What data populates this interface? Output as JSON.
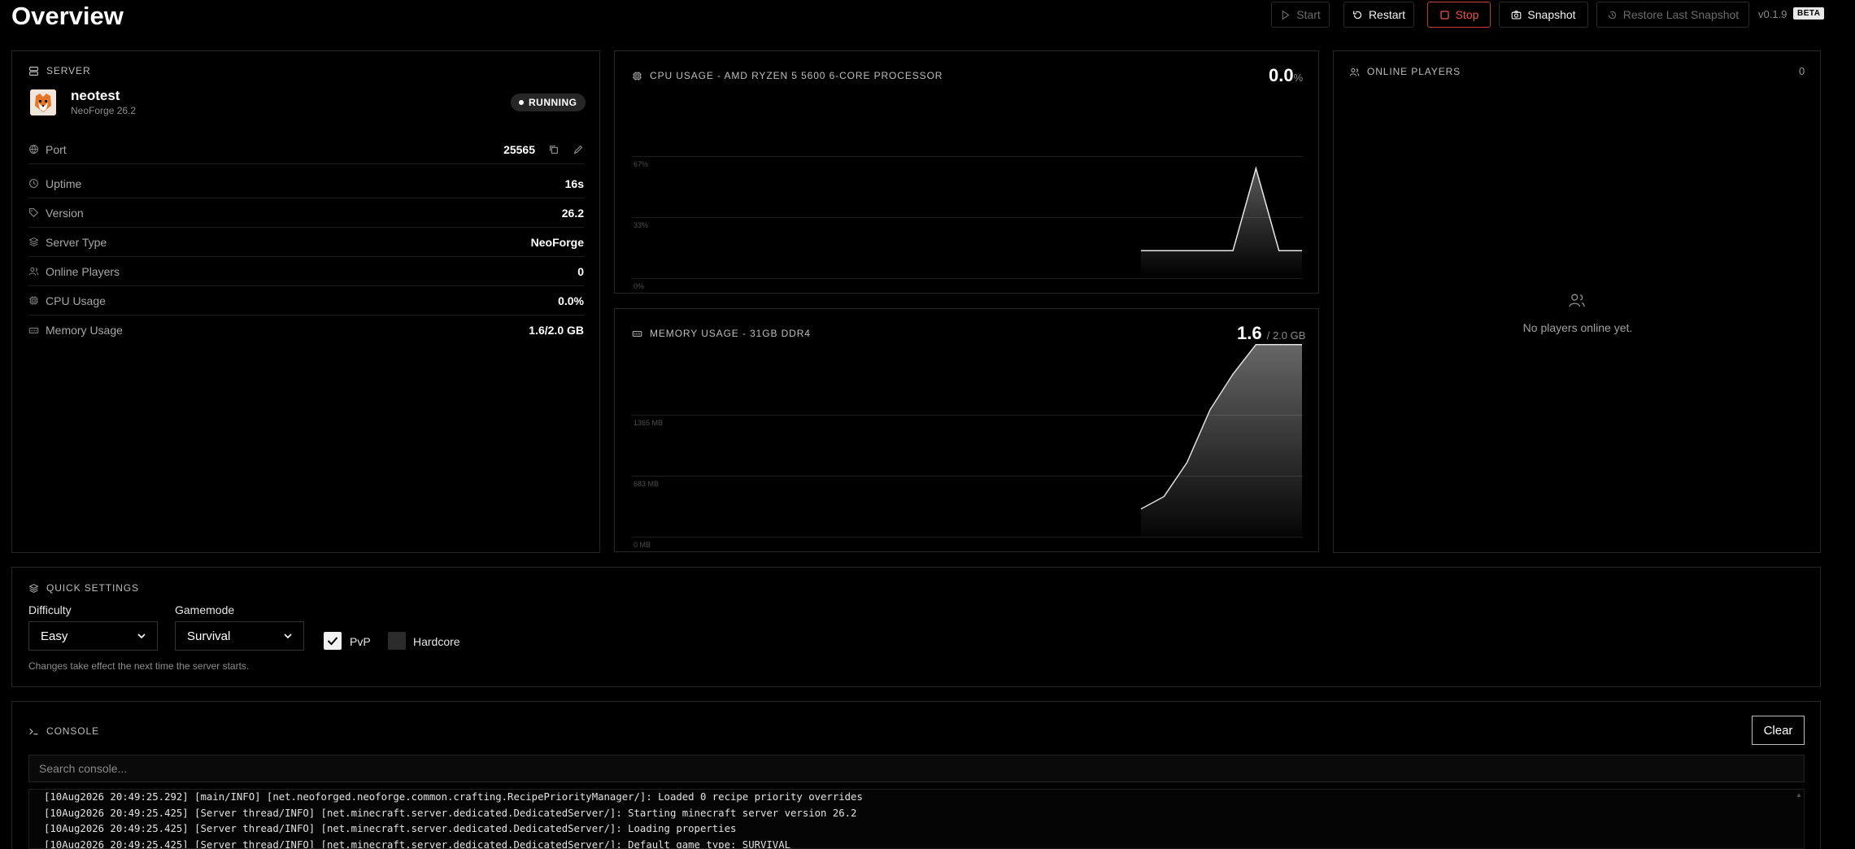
{
  "header": {
    "title": "Overview",
    "buttons": {
      "start": "Start",
      "restart": "Restart",
      "stop": "Stop",
      "snapshot": "Snapshot",
      "restore": "Restore Last Snapshot"
    },
    "version": "v0.1.9",
    "beta": "BETA"
  },
  "server": {
    "section_title": "SERVER",
    "name": "neotest",
    "subtitle": "NeoForge 26.2",
    "status": "RUNNING",
    "rows": [
      {
        "label": "Port",
        "value": "25565",
        "icon": "globe-icon"
      },
      {
        "label": "Uptime",
        "value": "16s",
        "icon": "clock-icon"
      },
      {
        "label": "Version",
        "value": "26.2",
        "icon": "tag-icon"
      },
      {
        "label": "Server Type",
        "value": "NeoForge",
        "icon": "layers-icon"
      },
      {
        "label": "Online Players",
        "value": "0",
        "icon": "users-icon"
      },
      {
        "label": "CPU Usage",
        "value": "0.0%",
        "icon": "cpu-icon"
      },
      {
        "label": "Memory Usage",
        "value": "1.6/2.0 GB",
        "icon": "memory-icon"
      }
    ]
  },
  "cpu": {
    "title": "CPU USAGE - AMD RYZEN 5 5600 6-CORE PROCESSOR",
    "value": "0.0",
    "unit": "%"
  },
  "memory": {
    "title": "MEMORY USAGE - 31GB DDR4",
    "value": "1.6",
    "unit": "/ 2.0 GB"
  },
  "players": {
    "title": "ONLINE PLAYERS",
    "count": "0",
    "empty": "No players online yet."
  },
  "quick_settings": {
    "title": "QUICK SETTINGS",
    "difficulty_label": "Difficulty",
    "difficulty_value": "Easy",
    "gamemode_label": "Gamemode",
    "gamemode_value": "Survival",
    "pvp_label": "PvP",
    "pvp_checked": true,
    "hardcore_label": "Hardcore",
    "hardcore_checked": false,
    "hint": "Changes take effect the next time the server starts."
  },
  "console": {
    "title": "CONSOLE",
    "clear": "Clear",
    "search_placeholder": "Search console...",
    "lines": [
      "[10Aug2026 20:49:25.292] [main/INFO] [net.neoforged.neoforge.common.crafting.RecipePriorityManager/]: Loaded 0 recipe priority overrides",
      "[10Aug2026 20:49:25.425] [Server thread/INFO] [net.minecraft.server.dedicated.DedicatedServer/]: Starting minecraft server version 26.2",
      "[10Aug2026 20:49:25.425] [Server thread/INFO] [net.minecraft.server.dedicated.DedicatedServer/]: Loading properties",
      "[10Aug2026 20:49:25.425] [Server thread/INFO] [net.minecraft.server.dedicated.DedicatedServer/]: Default game type: SURVIVAL"
    ]
  },
  "chart_data": [
    {
      "type": "area",
      "title": "CPU USAGE - AMD RYZEN 5 5600 6-CORE PROCESSOR",
      "y_ticks": [
        "67%",
        "33%",
        "0%"
      ],
      "ylim": [
        0,
        100
      ],
      "grid": true,
      "values": [
        15,
        15,
        15,
        15,
        15,
        60,
        15,
        15
      ],
      "xlabel": "",
      "ylabel": ""
    },
    {
      "type": "area",
      "title": "MEMORY USAGE - 31GB DDR4",
      "y_ticks": [
        "1365 MB",
        "683 MB",
        "0 MB"
      ],
      "ylim": [
        0,
        2048
      ],
      "grid": true,
      "values": [
        310,
        450,
        830,
        1420,
        1820,
        2300,
        2300,
        2270
      ],
      "xlabel": "",
      "ylabel": ""
    }
  ]
}
